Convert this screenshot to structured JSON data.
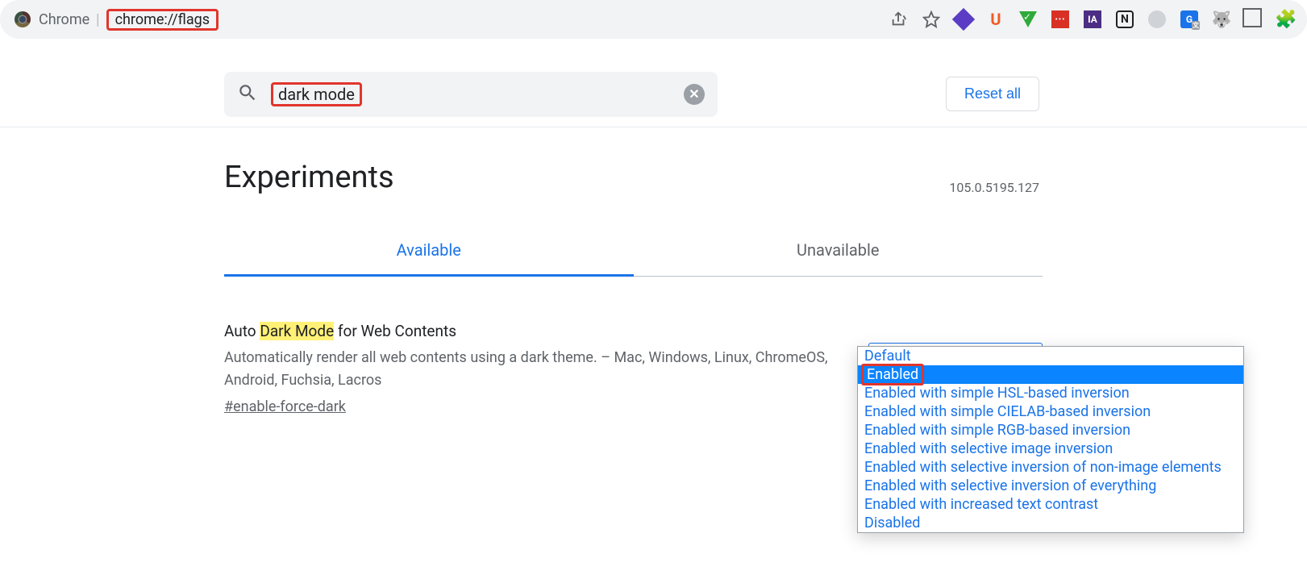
{
  "omnibox": {
    "label": "Chrome",
    "url": "chrome://flags"
  },
  "extensions": {
    "u_label": "U",
    "red_label": "•••",
    "ia_label": "IA",
    "n_label": "N",
    "g_label": "G"
  },
  "search": {
    "value": "dark mode"
  },
  "reset_label": "Reset all",
  "page_title": "Experiments",
  "version": "105.0.5195.127",
  "tabs": {
    "available": "Available",
    "unavailable": "Unavailable"
  },
  "flag": {
    "title_prefix": "Auto ",
    "title_highlight": "Dark Mode",
    "title_suffix": " for Web Contents",
    "description": "Automatically render all web contents using a dark theme. – Mac, Windows, Linux, ChromeOS, Android, Fuchsia, Lacros",
    "anchor": "#enable-force-dark",
    "selected_value": "Default"
  },
  "dropdown_options": [
    "Default",
    "Enabled",
    "Enabled with simple HSL-based inversion",
    "Enabled with simple CIELAB-based inversion",
    "Enabled with simple RGB-based inversion",
    "Enabled with selective image inversion",
    "Enabled with selective inversion of non-image elements",
    "Enabled with selective inversion of everything",
    "Enabled with increased text contrast",
    "Disabled"
  ],
  "dropdown_selected_index": 1
}
